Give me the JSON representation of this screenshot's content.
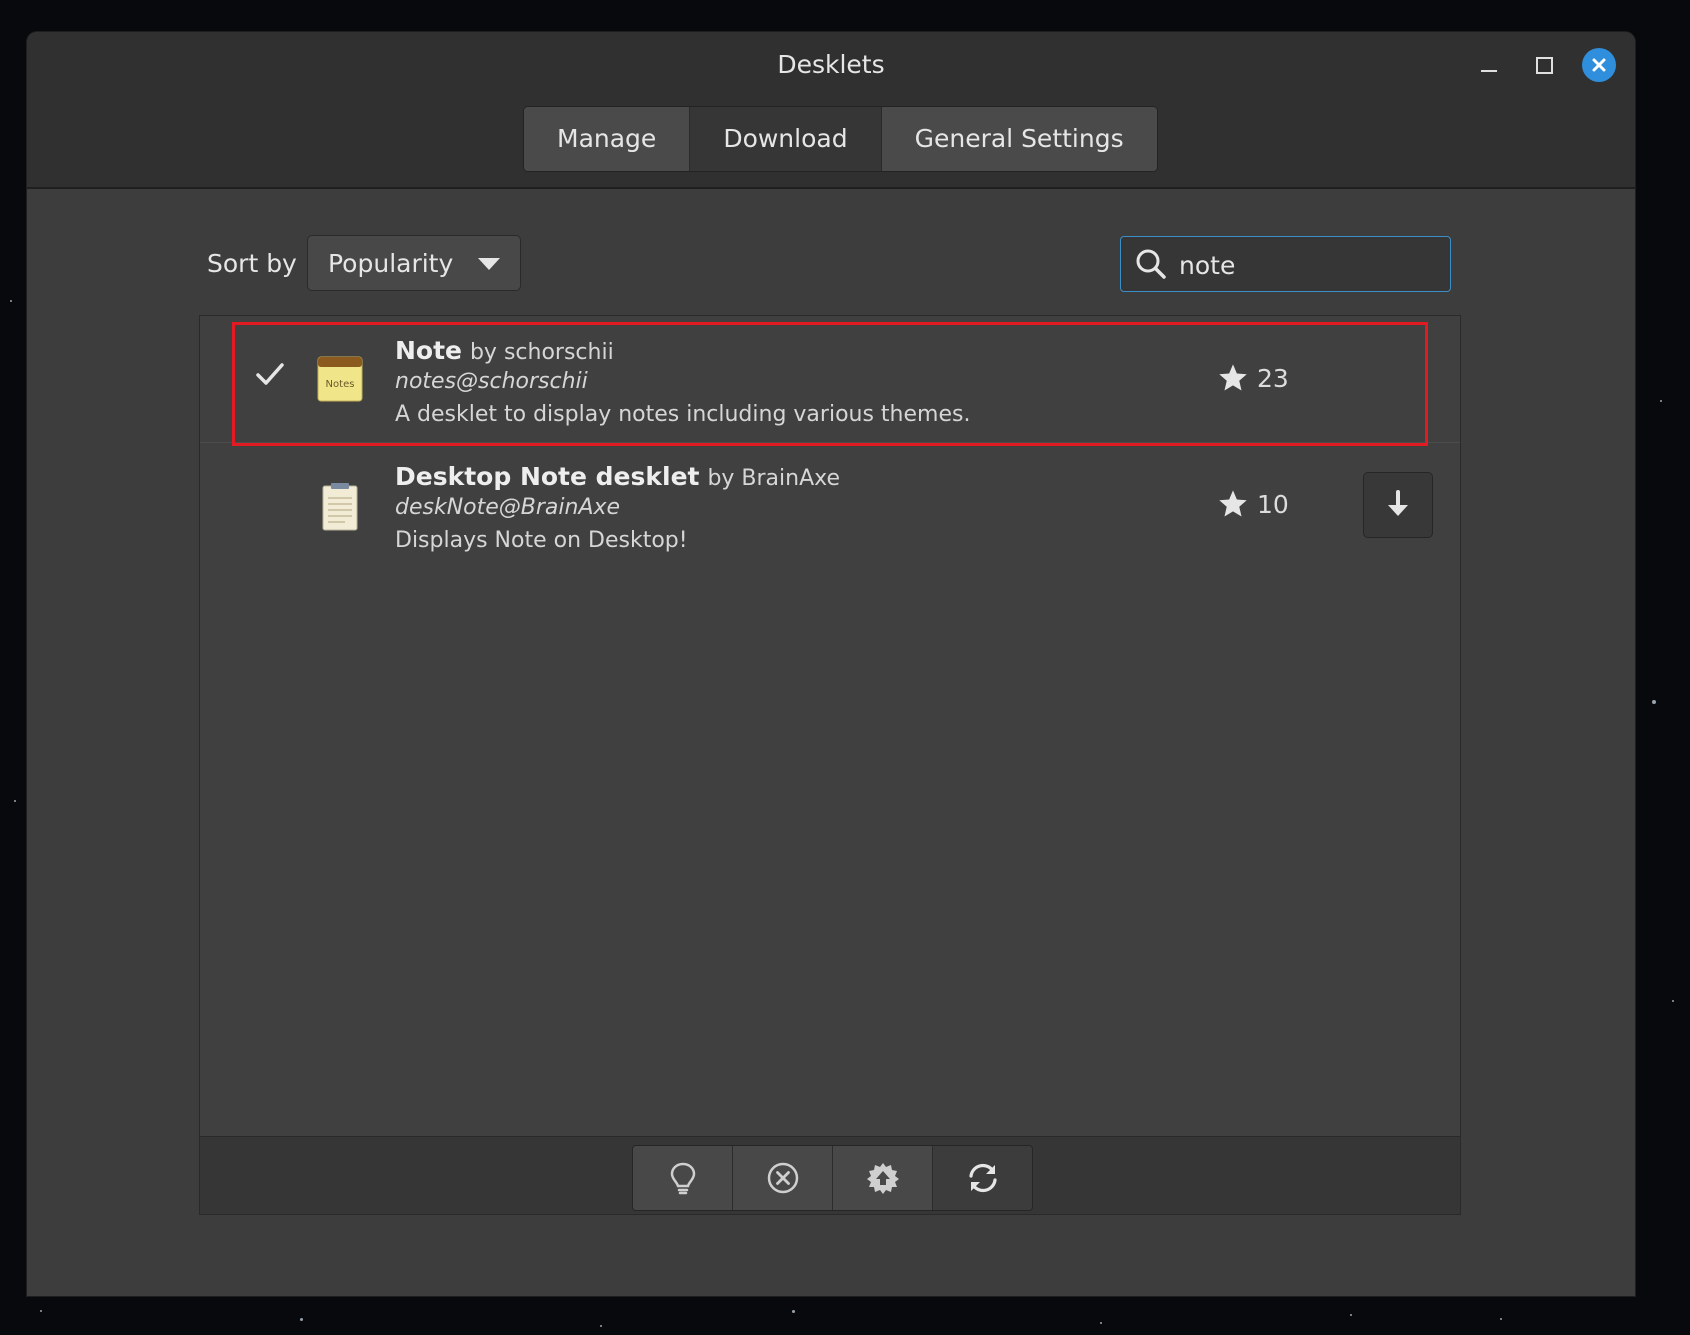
{
  "window": {
    "title": "Desklets",
    "controls": [
      "minimize-icon",
      "maximize-icon",
      "close-icon"
    ],
    "close_color": "#2f8fdc"
  },
  "tabs": [
    {
      "label": "Manage",
      "active": false
    },
    {
      "label": "Download",
      "active": true
    },
    {
      "label": "General Settings",
      "active": false
    }
  ],
  "sort": {
    "label": "Sort by",
    "value": "Popularity"
  },
  "search": {
    "value": "note",
    "focus_color": "#3b8ec7"
  },
  "results": [
    {
      "name": "Note",
      "by": "by schorschii",
      "uuid": "notes@schorschii",
      "description": "A desklet to display notes including various themes.",
      "rating": "23",
      "installed": true,
      "icon_label": "Notes",
      "highlighted": true,
      "highlight_color": "#e21a22"
    },
    {
      "name": "Desktop Note desklet",
      "by": "by BrainAxe",
      "uuid": "deskNote@BrainAxe",
      "description": "Displays Note on Desktop!",
      "rating": "10",
      "installed": false
    }
  ],
  "toolbar": [
    "lightbulb-icon",
    "remove-circle-icon",
    "upload-gear-icon",
    "refresh-icon"
  ]
}
